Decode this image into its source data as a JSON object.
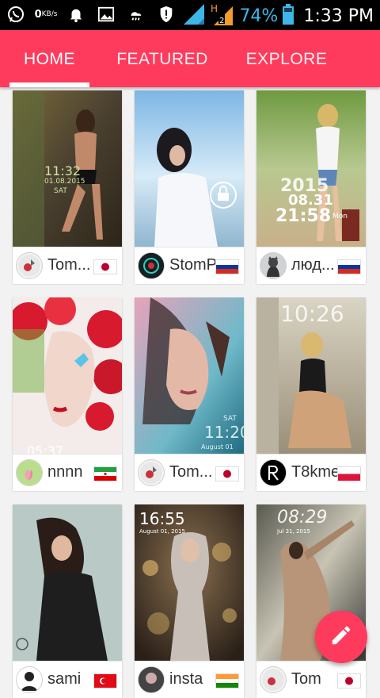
{
  "status_bar": {
    "net_speed_value": "0",
    "net_speed_unit": "KB/s",
    "battery_percent": "74%",
    "time": "1:33 PM",
    "icons": [
      "whatsapp-icon",
      "net-speed-icon",
      "notification-bell-icon",
      "image-icon",
      "weather-icon",
      "shield-icon",
      "signal-icon",
      "h-network-icon",
      "battery-icon"
    ]
  },
  "tabs": {
    "home": "HOME",
    "featured": "FEATURED",
    "explore": "EXPLORE",
    "active": "HOME",
    "accent_color": "#fe3b5c"
  },
  "grid": {
    "cards": [
      {
        "username": "Tom...",
        "flag": "japan",
        "lock_time": "11:32",
        "lock_date": "01.08.2015",
        "lock_day": "SAT"
      },
      {
        "username": "StomP",
        "flag": "russia"
      },
      {
        "username": "люд...",
        "flag": "russia",
        "lock_time": "21:58",
        "lock_date": "08.31",
        "lock_year": "2015",
        "lock_day": "Mon"
      },
      {
        "username": "nnnn",
        "flag": "iran",
        "lock_time": "05:37"
      },
      {
        "username": "Tom...",
        "flag": "japan",
        "lock_time": "11:20",
        "lock_day": "SAT",
        "lock_date": "August 01"
      },
      {
        "username": "T8kme",
        "flag": "poland",
        "lock_time": "10:26"
      },
      {
        "username": "sami",
        "flag": "turkey"
      },
      {
        "username": "insta",
        "flag": "india",
        "lock_time": "16:55",
        "lock_date": "August 01, 2015"
      },
      {
        "username": "Tom",
        "flag": "japan",
        "lock_time": "08:29",
        "lock_date": "Jul 31, 2015"
      }
    ]
  },
  "fab": {
    "icon": "pencil-icon"
  }
}
